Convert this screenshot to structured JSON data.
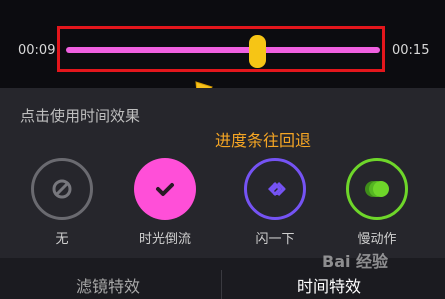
{
  "timeline": {
    "start_time": "00:09",
    "end_time": "00:15",
    "progress": 0.61
  },
  "panel": {
    "heading": "点击使用时间效果"
  },
  "annotation": {
    "text": "进度条往回退",
    "color": "#f5a524"
  },
  "effects": [
    {
      "label": "无",
      "icon": "no-entry-icon",
      "color": "#6a6a70"
    },
    {
      "label": "时光倒流",
      "icon": "checkmark-icon",
      "color": "#ff4fd8",
      "selected": true
    },
    {
      "label": "闪一下",
      "icon": "flash-diamond-icon",
      "color": "#7553f4"
    },
    {
      "label": "慢动作",
      "icon": "slow-motion-icon",
      "color": "#6ed62a"
    }
  ],
  "tabs": [
    {
      "label": "滤镜特效",
      "active": false
    },
    {
      "label": "时间特效",
      "active": true
    }
  ],
  "watermark": "Bai 经验",
  "colors": {
    "highlight_frame": "#e4161c",
    "track": "#f060e0",
    "knob": "#f6c515"
  }
}
